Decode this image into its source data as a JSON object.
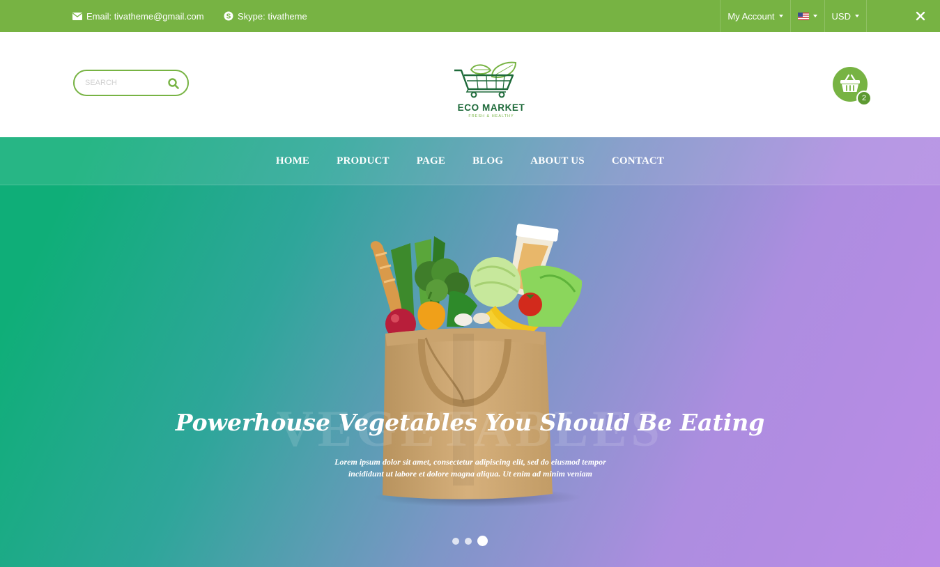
{
  "topbar": {
    "email_label": "Email: tivatheme@gmail.com",
    "skype_label": "Skype: tivatheme",
    "account_label": "My Account",
    "language_flag": "us-flag-icon",
    "currency_label": "USD",
    "close_icon": "close-icon"
  },
  "header": {
    "search_placeholder": "SEARCH",
    "logo_name": "ECO MARKET",
    "logo_tagline": "FRESH & HEALTHY",
    "cart_count": "2"
  },
  "nav": {
    "items": [
      "HOME",
      "PRODUCT",
      "PAGE",
      "BLOG",
      "ABOUT US",
      "CONTACT"
    ]
  },
  "hero": {
    "watermark": "VEGETABLES",
    "headline": "Powerhouse Vegetables You Should Be Eating",
    "description_line1": "Lorem ipsum dolor sit amet, consectetur adipiscing elit, sed do eiusmod tempor",
    "description_line2": "incididunt ut labore et dolore magna aliqua. Ut enim ad minim veniam",
    "slides": 3,
    "active_slide": 3
  },
  "colors": {
    "brand_green": "#77b343",
    "logo_dark_green": "#1e6a3a",
    "hero_gradient_start": "#0fae78",
    "hero_gradient_end": "#bb8be6"
  }
}
